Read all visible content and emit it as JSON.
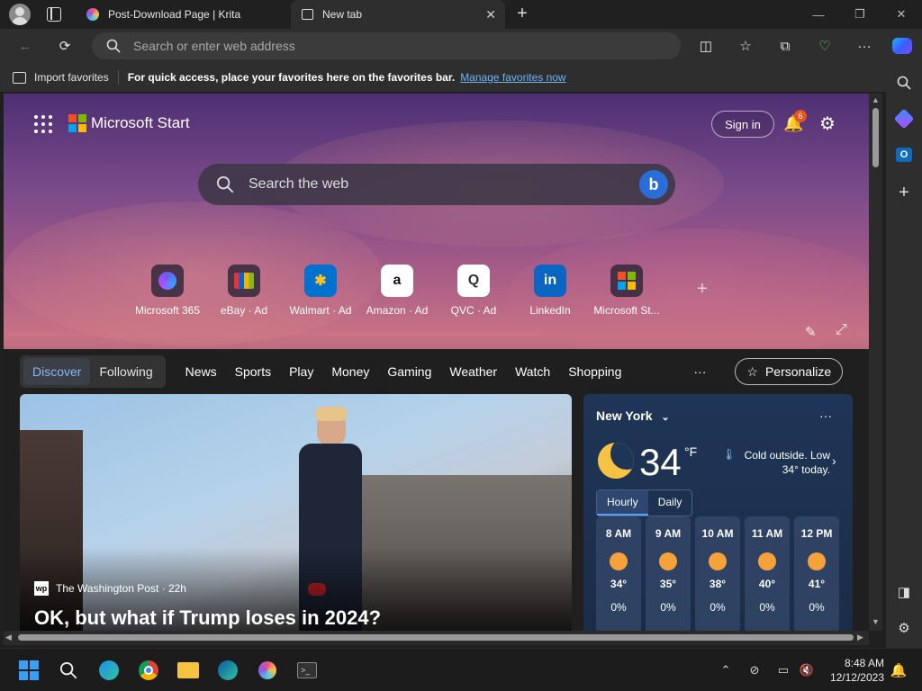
{
  "browser": {
    "tabs": [
      {
        "title": "Post-Download Page | Krita"
      },
      {
        "title": "New tab"
      }
    ],
    "address_placeholder": "Search or enter web address",
    "favbar": {
      "import_label": "Import favorites",
      "message": "For quick access, place your favorites here on the favorites bar.",
      "manage_link": "Manage favorites now"
    }
  },
  "msstart": {
    "logo_text": "Microsoft Start",
    "signin_label": "Sign in",
    "notification_count": "6",
    "search_placeholder": "Search the web",
    "quicklinks": [
      {
        "label": "Microsoft 365",
        "icon": "ms365-icon"
      },
      {
        "label": "eBay · Ad",
        "icon": "ebay-icon"
      },
      {
        "label": "Walmart · Ad",
        "icon": "walmart-icon"
      },
      {
        "label": "Amazon · Ad",
        "icon": "amazon-icon"
      },
      {
        "label": "QVC · Ad",
        "icon": "qvc-icon"
      },
      {
        "label": "LinkedIn",
        "icon": "linkedin-icon"
      },
      {
        "label": "Microsoft St...",
        "icon": "msstore-icon"
      }
    ],
    "feed_tabs": [
      "Discover",
      "Following"
    ],
    "categories": [
      "News",
      "Sports",
      "Play",
      "Money",
      "Gaming",
      "Weather",
      "Watch",
      "Shopping"
    ],
    "more_label": "···",
    "personalize_label": "Personalize"
  },
  "hero": {
    "source": "The Washington Post · 22h",
    "headline": "OK, but what if Trump loses in 2024?"
  },
  "weather": {
    "location": "New York",
    "temp": "34",
    "unit": "°F",
    "note": "Cold outside. Low 34° today.",
    "toggle": [
      "Hourly",
      "Daily"
    ],
    "hours": [
      {
        "time": "8 AM",
        "temp": "34°",
        "precip": "0%"
      },
      {
        "time": "9 AM",
        "temp": "35°",
        "precip": "0%"
      },
      {
        "time": "10 AM",
        "temp": "38°",
        "precip": "0%"
      },
      {
        "time": "11 AM",
        "temp": "40°",
        "precip": "0%"
      },
      {
        "time": "12 PM",
        "temp": "41°",
        "precip": "0%"
      }
    ]
  },
  "taskbar": {
    "time": "8:48 AM",
    "date": "12/12/2023"
  },
  "colors": {
    "accent": "#0078d4",
    "link": "#6fb4f5",
    "badge": "#e8531f"
  }
}
